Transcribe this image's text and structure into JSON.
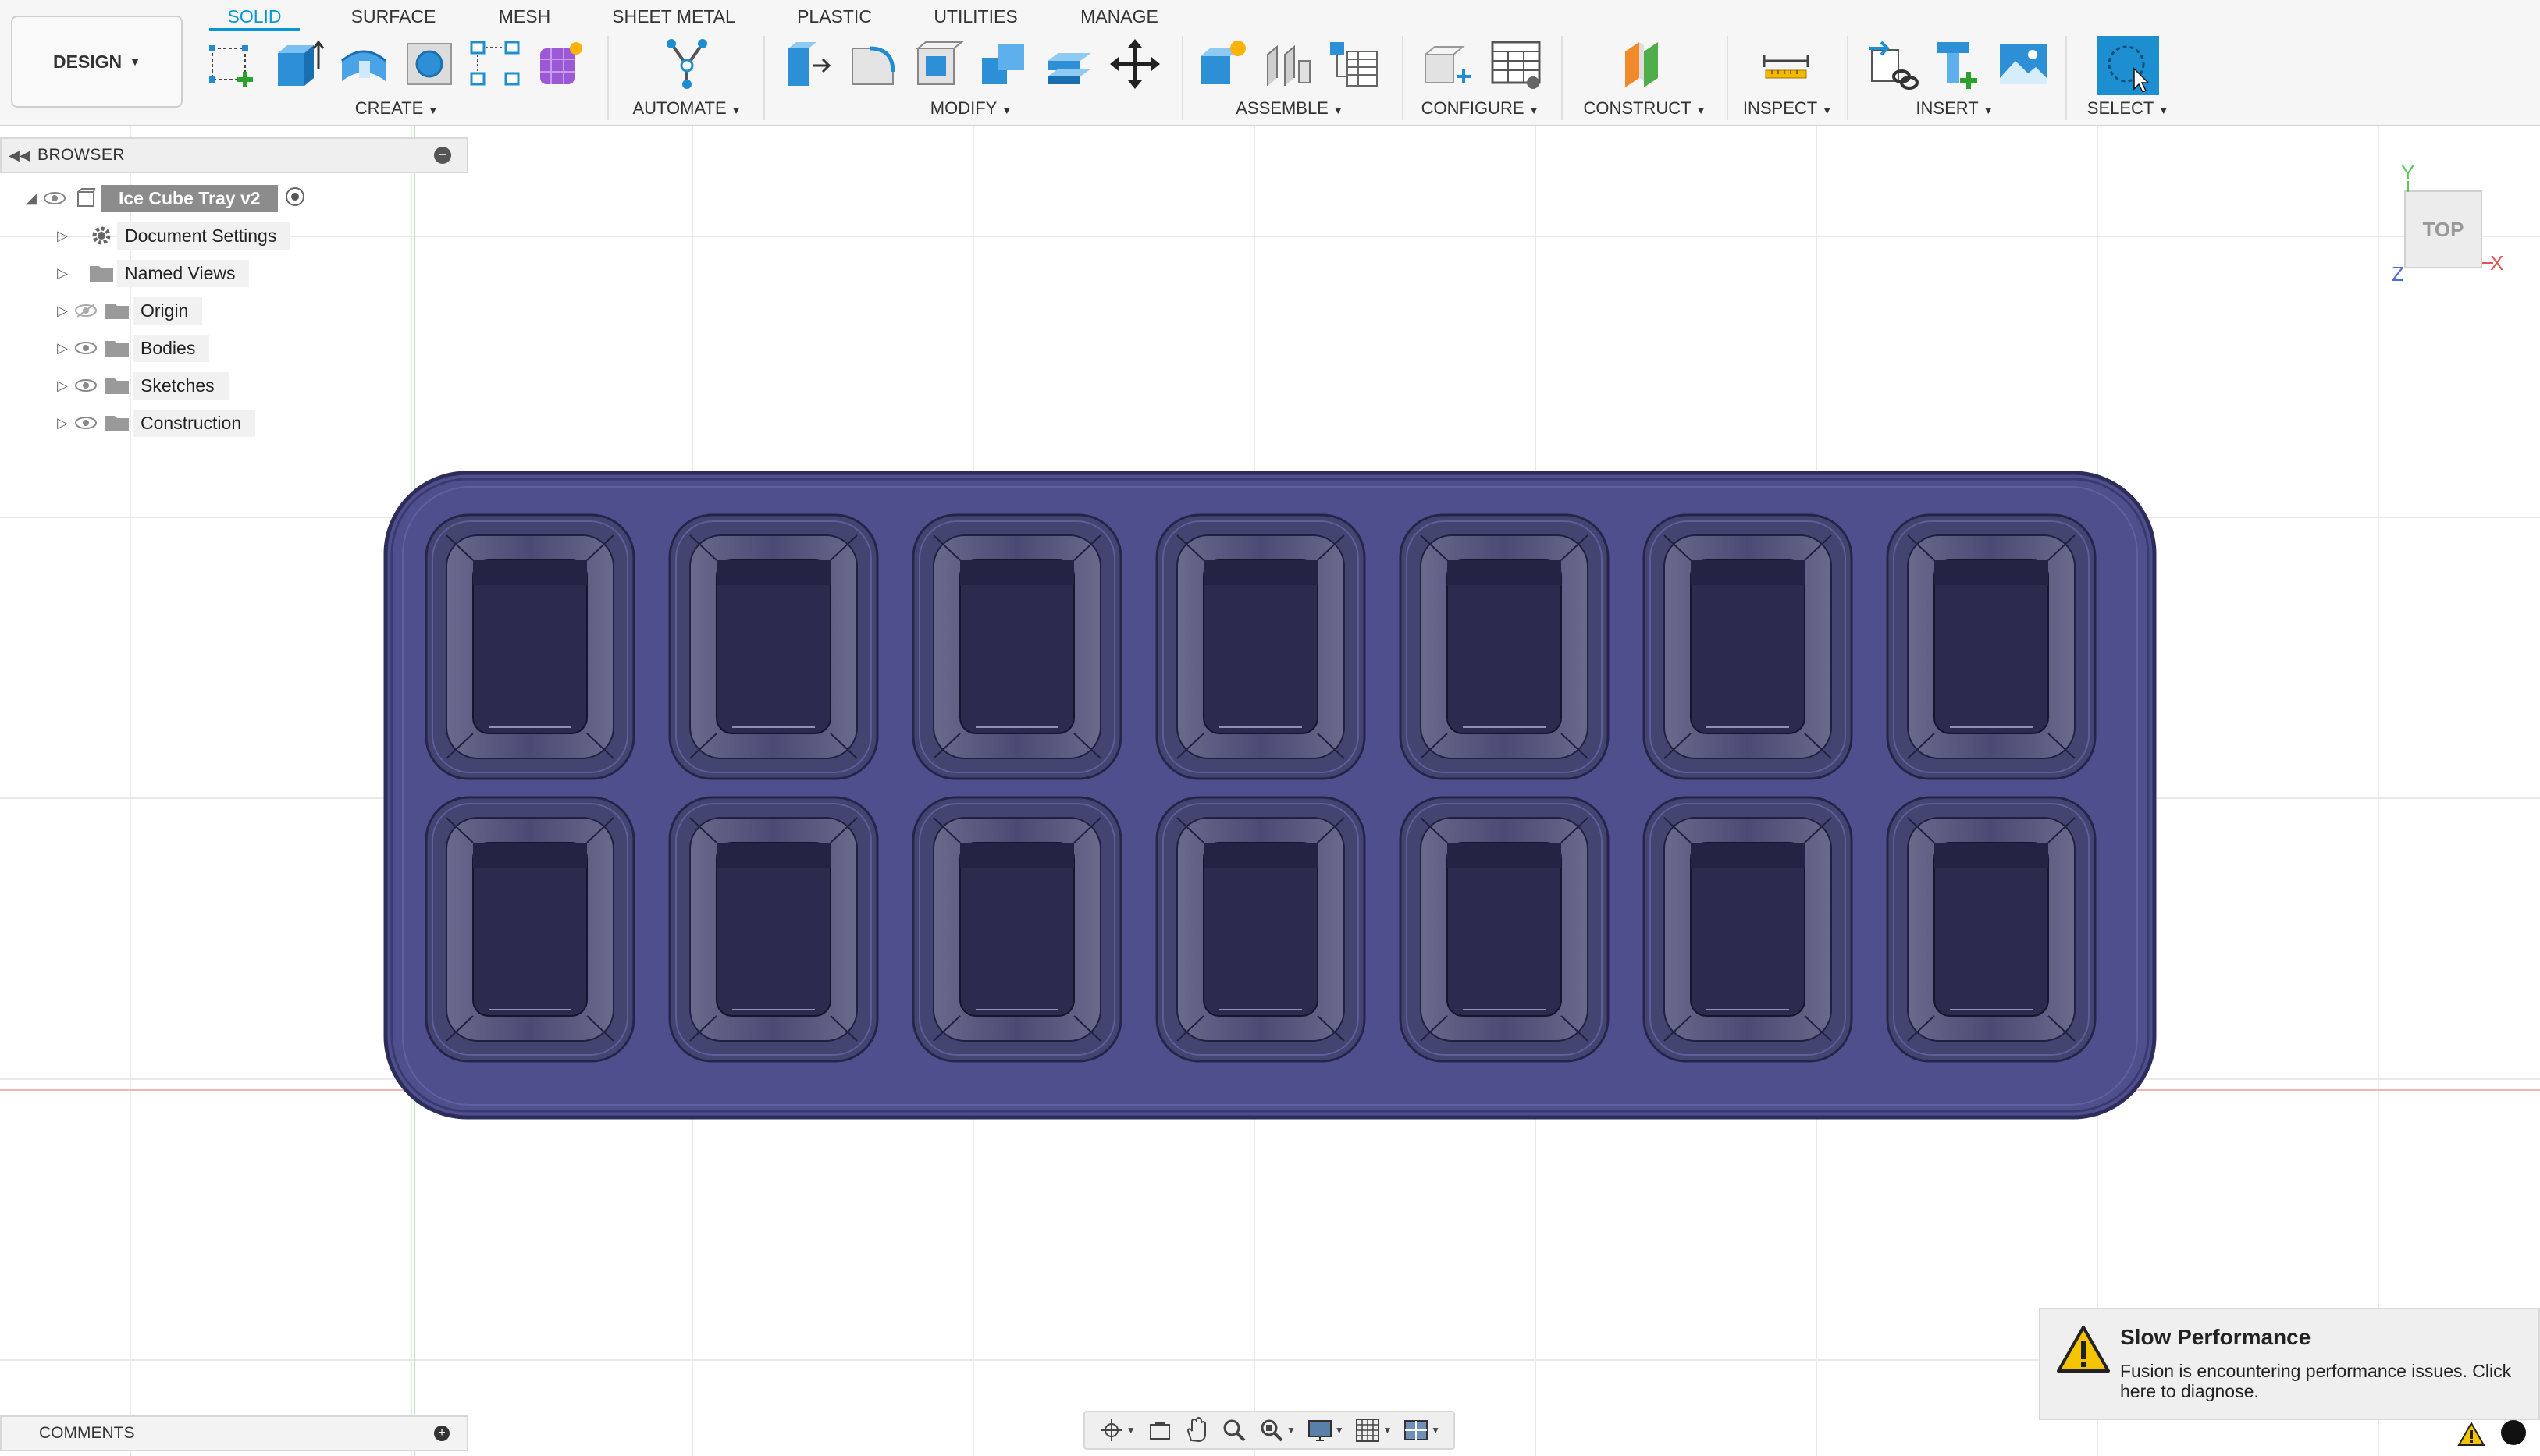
{
  "workspace": {
    "label": "DESIGN"
  },
  "tabs": [
    "SOLID",
    "SURFACE",
    "MESH",
    "SHEET METAL",
    "PLASTIC",
    "UTILITIES",
    "MANAGE"
  ],
  "active_tab": "SOLID",
  "groups": {
    "create": "CREATE",
    "automate": "AUTOMATE",
    "modify": "MODIFY",
    "assemble": "ASSEMBLE",
    "configure": "CONFIGURE",
    "construct": "CONSTRUCT",
    "inspect": "INSPECT",
    "insert": "INSERT",
    "select": "SELECT"
  },
  "browser": {
    "title": "BROWSER",
    "root": "Ice Cube Tray v2",
    "items": [
      {
        "label": "Document Settings",
        "icon": "gear-icon"
      },
      {
        "label": "Named Views",
        "icon": "folder-icon"
      },
      {
        "label": "Origin",
        "icon": "folder-icon"
      },
      {
        "label": "Bodies",
        "icon": "folder-icon"
      },
      {
        "label": "Sketches",
        "icon": "folder-icon"
      },
      {
        "label": "Construction",
        "icon": "folder-icon"
      }
    ]
  },
  "viewcube": {
    "face": "TOP",
    "y": "Y",
    "x": "X",
    "z": "Z"
  },
  "comments": {
    "title": "COMMENTS"
  },
  "model": {
    "rows": 2,
    "columns": 7,
    "body_color": "#4e4f8c"
  },
  "notification": {
    "title": "Slow Performance",
    "body": "Fusion is encountering performance issues. Click here to diagnose."
  },
  "colors": {
    "accent": "#0696d7",
    "warning": "#f5c400"
  }
}
